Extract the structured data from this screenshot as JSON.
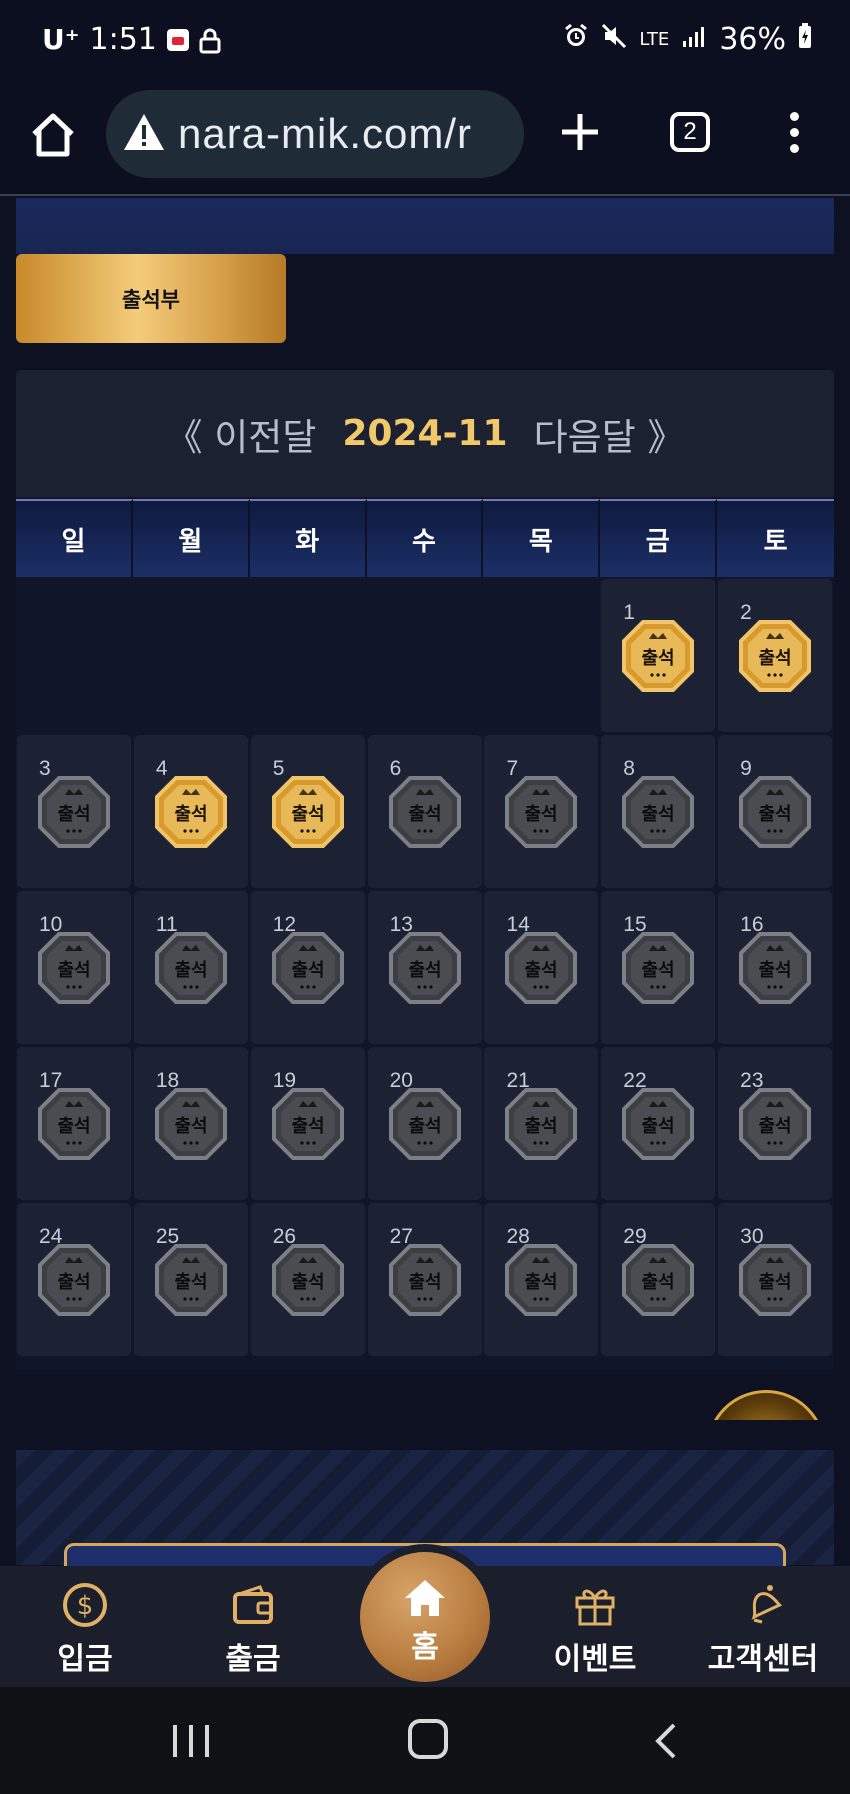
{
  "status_bar": {
    "carrier": "U⁺",
    "time": "1:51",
    "net": "LTE",
    "battery": "36%"
  },
  "browser": {
    "url": "nara-mik.com/r",
    "tab_count": "2"
  },
  "page": {
    "attendance_button": "출석부",
    "calendar": {
      "prev": "《 이전달",
      "month": "2024-11",
      "next": "다음달 》",
      "weekdays": [
        "일",
        "월",
        "화",
        "수",
        "목",
        "금",
        "토"
      ],
      "first_weekday_index": 5,
      "days": [
        {
          "day": "1",
          "attended": true
        },
        {
          "day": "2",
          "attended": true
        },
        {
          "day": "3",
          "attended": false
        },
        {
          "day": "4",
          "attended": true
        },
        {
          "day": "5",
          "attended": true
        },
        {
          "day": "6",
          "attended": false
        },
        {
          "day": "7",
          "attended": false
        },
        {
          "day": "8",
          "attended": false
        },
        {
          "day": "9",
          "attended": false
        },
        {
          "day": "10",
          "attended": false
        },
        {
          "day": "11",
          "attended": false
        },
        {
          "day": "12",
          "attended": false
        },
        {
          "day": "13",
          "attended": false
        },
        {
          "day": "14",
          "attended": false
        },
        {
          "day": "15",
          "attended": false
        },
        {
          "day": "16",
          "attended": false
        },
        {
          "day": "17",
          "attended": false
        },
        {
          "day": "18",
          "attended": false
        },
        {
          "day": "19",
          "attended": false
        },
        {
          "day": "20",
          "attended": false
        },
        {
          "day": "21",
          "attended": false
        },
        {
          "day": "22",
          "attended": false
        },
        {
          "day": "23",
          "attended": false
        },
        {
          "day": "24",
          "attended": false
        },
        {
          "day": "25",
          "attended": false
        },
        {
          "day": "26",
          "attended": false
        },
        {
          "day": "27",
          "attended": false
        },
        {
          "day": "28",
          "attended": false
        },
        {
          "day": "29",
          "attended": false
        },
        {
          "day": "30",
          "attended": false
        }
      ],
      "badge_label": "출석"
    }
  },
  "bottom_nav": {
    "deposit": "입금",
    "withdraw": "출금",
    "home": "홈",
    "event": "이벤트",
    "support": "고객센터"
  },
  "colors": {
    "accent_gold": "#f2c96a",
    "background": "#0d1122"
  }
}
